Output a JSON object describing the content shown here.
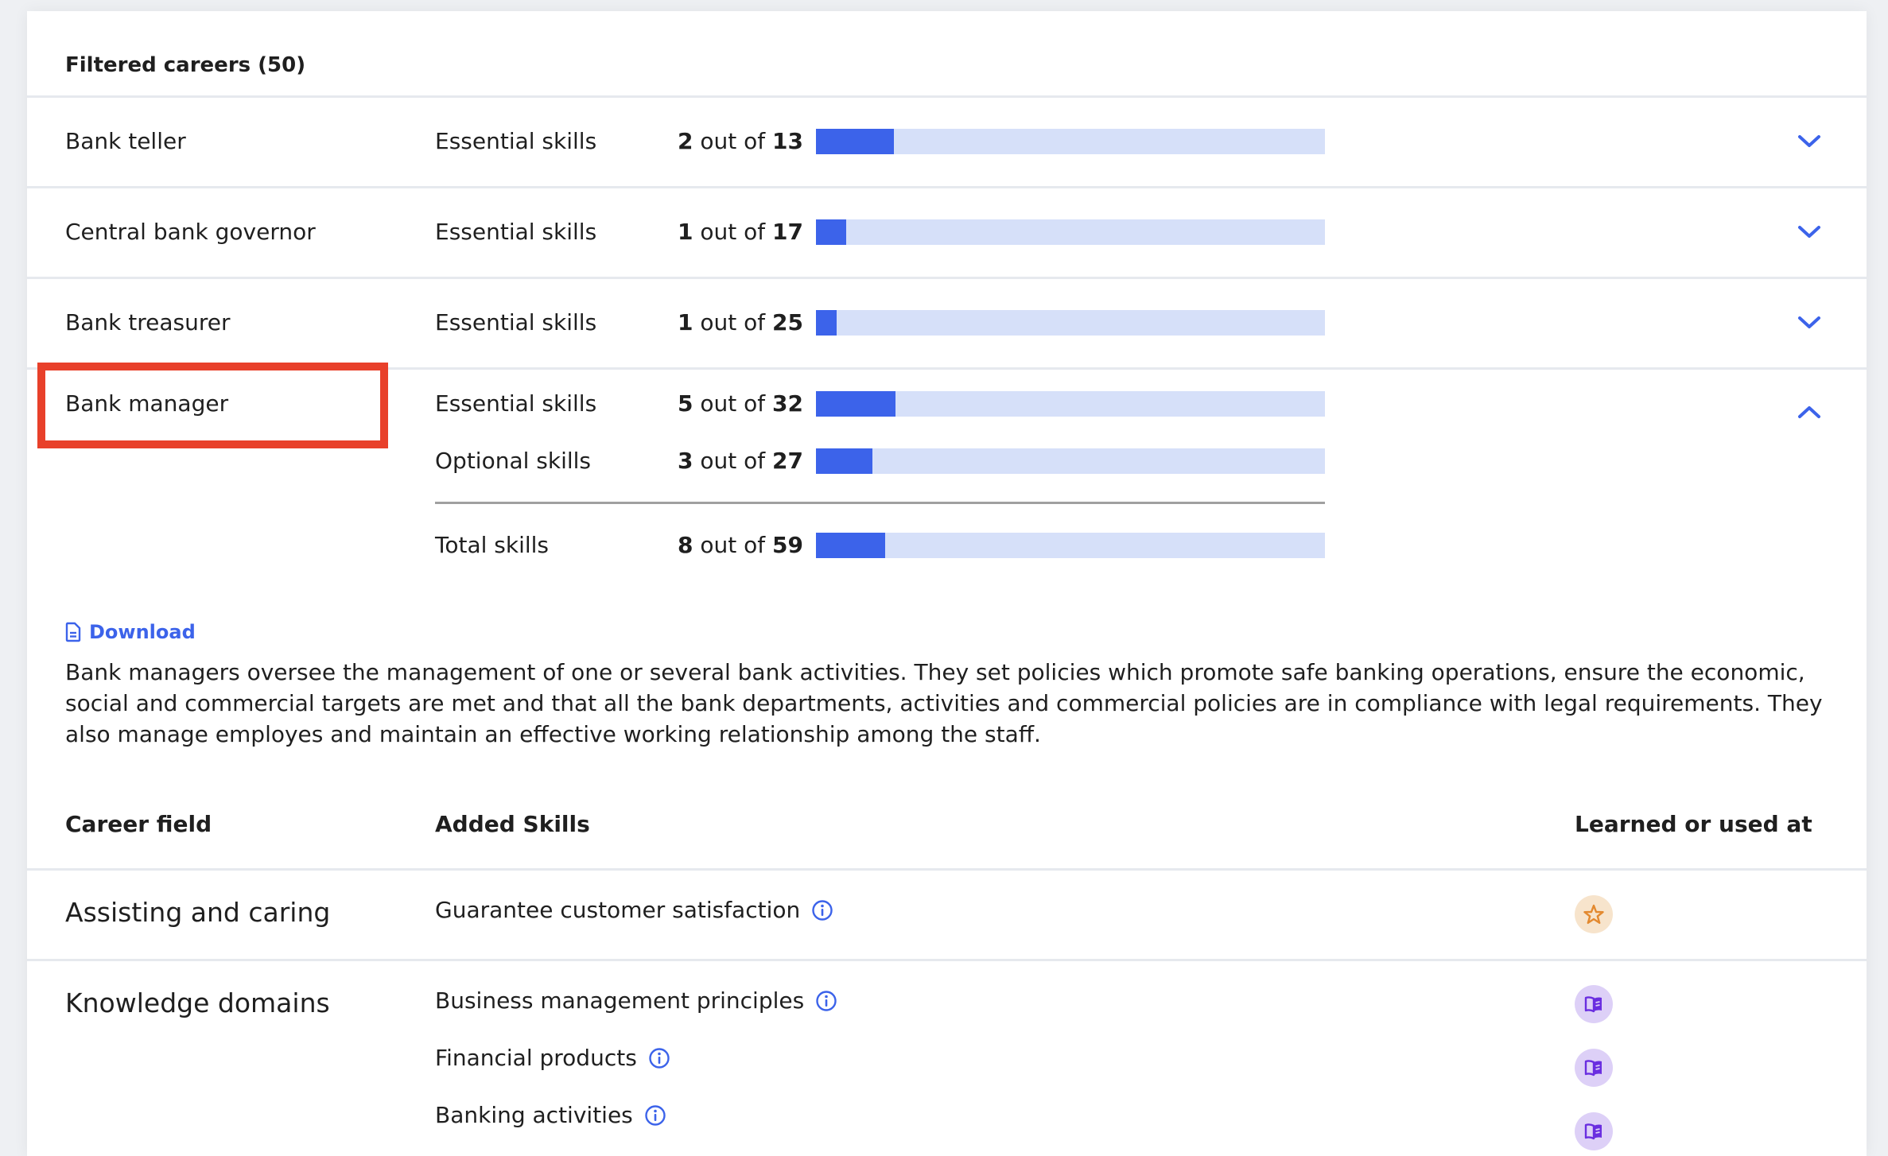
{
  "header": {
    "title": "Filtered careers (50)"
  },
  "careers": [
    {
      "name": "Bank teller",
      "expanded": false,
      "skills": [
        {
          "label": "Essential skills",
          "have": "2",
          "middle": " out of ",
          "total": "13",
          "progress": 0.1538
        }
      ]
    },
    {
      "name": "Central bank governor",
      "expanded": false,
      "skills": [
        {
          "label": "Essential skills",
          "have": "1",
          "middle": " out of ",
          "total": "17",
          "progress": 0.0588
        }
      ]
    },
    {
      "name": "Bank treasurer",
      "expanded": false,
      "skills": [
        {
          "label": "Essential skills",
          "have": "1",
          "middle": " out of ",
          "total": "25",
          "progress": 0.04
        }
      ]
    },
    {
      "name": "Bank manager",
      "expanded": true,
      "highlighted": true,
      "skills": [
        {
          "label": "Essential skills",
          "have": "5",
          "middle": " out of ",
          "total": "32",
          "progress": 0.1563
        },
        {
          "label": "Optional skills",
          "have": "3",
          "middle": " out of ",
          "total": "27",
          "progress": 0.1111
        }
      ],
      "total": {
        "label": "Total skills",
        "have": "8",
        "middle": " out of ",
        "total": "59",
        "progress": 0.1356
      },
      "download_label": "Download",
      "description": "Bank managers oversee the management of one or several bank activities. They set policies which promote safe banking operations, ensure the economic, social and commercial targets are met and that all the bank departments, activities and commercial policies are in compliance with legal requirements. They also manage employes and maintain an effective working relationship among the staff.",
      "table": {
        "headers": [
          "Career field",
          "Added Skills",
          "Learned or used at"
        ],
        "rows": [
          {
            "field": "Assisting and caring",
            "skills": [
              {
                "name": "Guarantee customer satisfaction",
                "source_icon": "star-icon"
              }
            ]
          },
          {
            "field": "Knowledge domains",
            "skills": [
              {
                "name": "Business management principles",
                "source_icon": "book-icon"
              },
              {
                "name": "Financial products",
                "source_icon": "book-icon"
              },
              {
                "name": "Banking activities",
                "source_icon": "book-icon"
              }
            ]
          }
        ]
      }
    }
  ],
  "colors": {
    "accent": "#3c63ea",
    "bar_track": "#d6e0f9",
    "highlight": "#e8402a",
    "star_bg": "#f7e4cc",
    "star_fg": "#e3892f",
    "book_bg": "#ddd0f7",
    "book_fg": "#6a2ee0"
  }
}
